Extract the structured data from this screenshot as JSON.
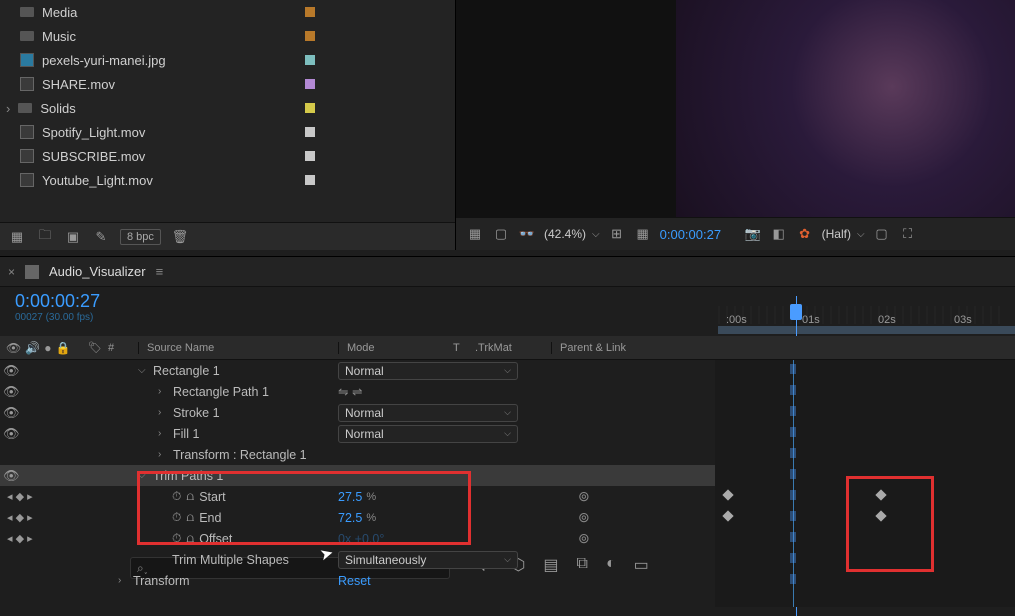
{
  "project": {
    "files": [
      {
        "name": "Media",
        "type": "folder",
        "swatch": "sw-orange"
      },
      {
        "name": "Music",
        "type": "folder",
        "swatch": "sw-orange"
      },
      {
        "name": "pexels-yuri-manei.jpg",
        "type": "jpg",
        "swatch": "sw-cyan"
      },
      {
        "name": "SHARE.mov",
        "type": "mov",
        "swatch": "sw-purple"
      },
      {
        "name": "Solids",
        "type": "folder-open",
        "swatch": "sw-yellow"
      },
      {
        "name": "Spotify_Light.mov",
        "type": "mov",
        "swatch": "sw-light"
      },
      {
        "name": "SUBSCRIBE.mov",
        "type": "mov",
        "swatch": "sw-light"
      },
      {
        "name": "Youtube_Light.mov",
        "type": "mov",
        "swatch": "sw-light"
      }
    ],
    "bpc": "8 bpc"
  },
  "preview": {
    "zoom": "(42.4%)",
    "timecode": "0:00:00:27",
    "quality": "(Half)"
  },
  "timeline": {
    "tab": "Audio_Visualizer",
    "timecode": "0:00:00:27",
    "frames": "00027 (30.00 fps)",
    "ruler": [
      ":00s",
      "01s",
      "02s",
      "03s"
    ],
    "columns": {
      "num": "#",
      "source": "Source Name",
      "mode": "Mode",
      "t": "T",
      "trk": ".TrkMat",
      "parent": "Parent & Link"
    },
    "layers": [
      {
        "name": "Rectangle 1",
        "depth": 0,
        "mode": "Normal",
        "twirl": "⌵",
        "eye": true
      },
      {
        "name": "Rectangle Path 1",
        "depth": 1,
        "twirl": "›",
        "eye": true,
        "custom_mode": "icons"
      },
      {
        "name": "Stroke 1",
        "depth": 1,
        "twirl": "›",
        "mode": "Normal",
        "eye": true
      },
      {
        "name": "Fill 1",
        "depth": 1,
        "twirl": "›",
        "mode": "Normal",
        "eye": true
      },
      {
        "name": "Transform : Rectangle 1",
        "depth": 1,
        "twirl": "›"
      },
      {
        "name": "Trim Paths 1",
        "depth": 0,
        "twirl": "⌵",
        "selected": true,
        "eye": true
      },
      {
        "name": "Start",
        "depth": 2,
        "value": "27.5",
        "unit": "%",
        "stopwatch": true,
        "graph": true,
        "parent_link": true,
        "nav": true
      },
      {
        "name": "End",
        "depth": 2,
        "value": "72.5",
        "unit": "%",
        "stopwatch": true,
        "graph": true,
        "parent_link": true,
        "nav": true
      },
      {
        "name": "Offset",
        "depth": 2,
        "value": "0x +0.0°",
        "stopwatch": true,
        "graph": true,
        "parent_link": true,
        "nav": true,
        "dimmed": true
      },
      {
        "name": "Trim Multiple Shapes",
        "depth": 2,
        "mode": "Simultaneously"
      },
      {
        "name": "Transform",
        "depth": -1,
        "twirl": "›",
        "reset": "Reset"
      }
    ]
  }
}
